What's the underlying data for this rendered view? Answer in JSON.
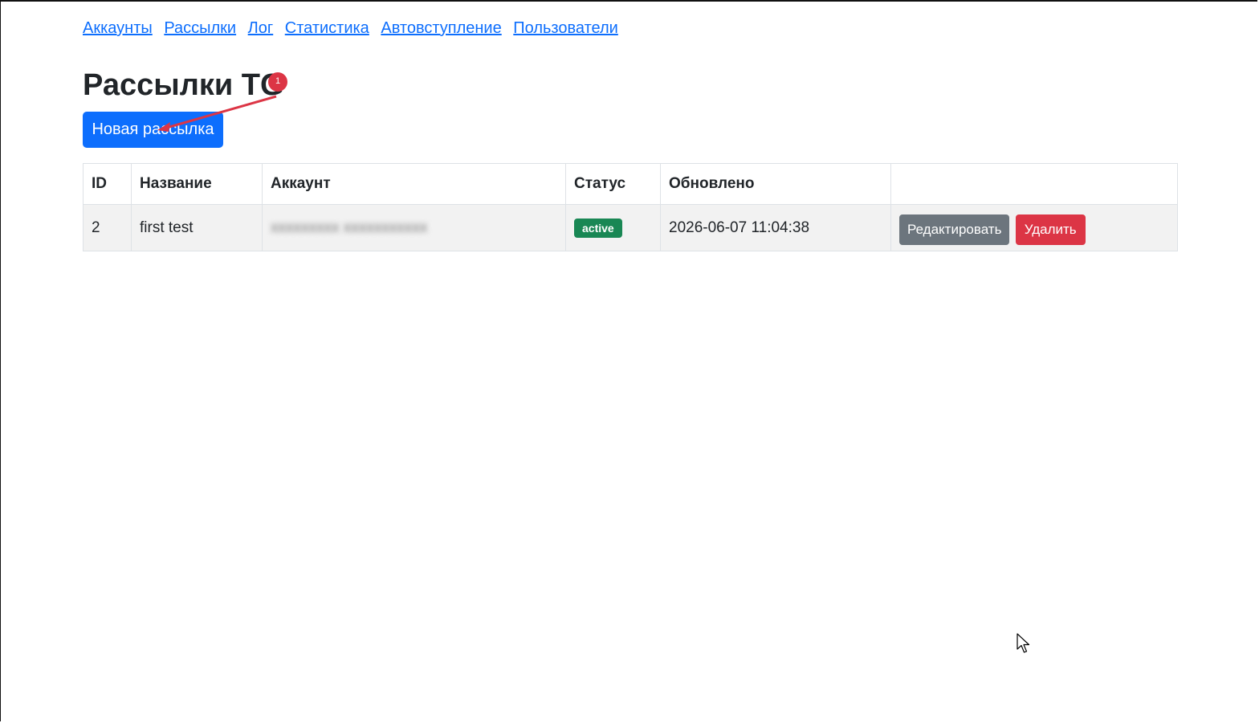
{
  "nav": {
    "items": [
      "Аккаунты",
      "Рассылки",
      "Лог",
      "Статистика",
      "Автовступление",
      "Пользователи"
    ]
  },
  "page": {
    "title": "Рассылки TG",
    "new_button": "Новая рассылка"
  },
  "annotation": {
    "marker_label": "1",
    "marker_color": "#dc3545"
  },
  "table": {
    "headers": [
      "ID",
      "Название",
      "Аккаунт",
      "Статус",
      "Обновлено",
      ""
    ],
    "rows": [
      {
        "id": "2",
        "name": "first test",
        "account": "xxxxxxxxx xxxxxxxxxxx",
        "status": "active",
        "updated": "2026-06-07 11:04:38",
        "edit_label": "Редактировать",
        "delete_label": "Удалить"
      }
    ]
  },
  "colors": {
    "primary": "#0d6efd",
    "secondary": "#6c757d",
    "danger": "#dc3545",
    "success": "#198754"
  }
}
